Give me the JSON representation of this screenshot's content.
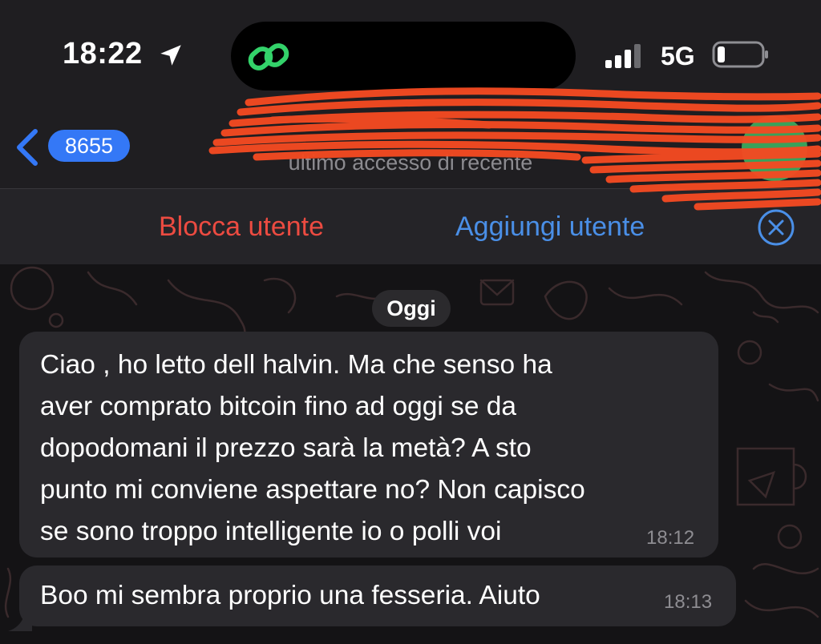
{
  "status_bar": {
    "time": "18:22",
    "network": "5G",
    "icons": [
      "location-arrow-icon",
      "link-app-icon",
      "signal-bars-icon",
      "battery-icon"
    ]
  },
  "header": {
    "back_count": "8655",
    "last_seen": "ultimo accesso di recente"
  },
  "action_bar": {
    "block_label": "Blocca utente",
    "add_label": "Aggiungi utente",
    "colors": {
      "block": "#ec4b41",
      "add": "#4a8fe7"
    }
  },
  "chat": {
    "date_label": "Oggi",
    "messages": [
      {
        "text": "Ciao , ho letto dell halvin. Ma che senso ha\naver comprato  bitcoin fino ad oggi se da\ndopodomani il prezzo sarà la metà? A sto\npunto mi conviene aspettare no? Non capisco\nse sono troppo intelligente io o polli voi",
        "time": "18:12"
      },
      {
        "text": "Boo mi sembra proprio una fesseria.  Aiuto",
        "time": "18:13"
      }
    ]
  },
  "colors": {
    "accent": "#3478f6",
    "bubble": "#2a292d",
    "redaction": "#f44a22"
  }
}
